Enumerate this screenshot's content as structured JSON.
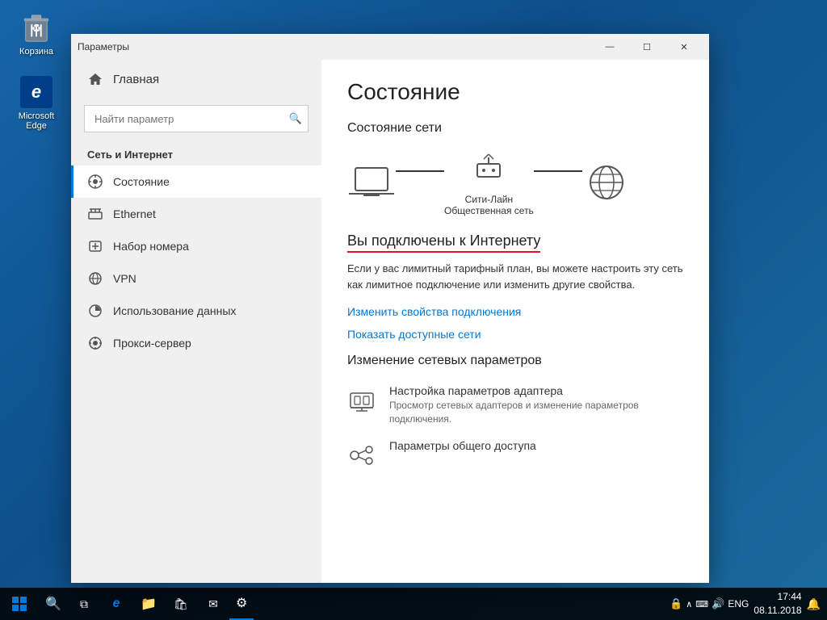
{
  "desktop": {
    "icons": [
      {
        "id": "recycle-bin",
        "label": "Корзина"
      },
      {
        "id": "edge",
        "label": "Microsoft Edge"
      }
    ]
  },
  "taskbar": {
    "time": "17:44",
    "date": "08.11.2018",
    "lang": "ENG",
    "apps": []
  },
  "window": {
    "title": "Параметры",
    "controls": {
      "minimize": "—",
      "maximize": "☐",
      "close": "✕"
    }
  },
  "sidebar": {
    "home_label": "Главная",
    "search_placeholder": "Найти параметр",
    "section_title": "Сеть и Интернет",
    "items": [
      {
        "id": "status",
        "label": "Состояние",
        "active": true
      },
      {
        "id": "ethernet",
        "label": "Ethernet"
      },
      {
        "id": "dialup",
        "label": "Набор номера"
      },
      {
        "id": "vpn",
        "label": "VPN"
      },
      {
        "id": "data-usage",
        "label": "Использование данных"
      },
      {
        "id": "proxy",
        "label": "Прокси-сервер"
      }
    ]
  },
  "content": {
    "page_title": "Состояние",
    "network_status_heading": "Состояние сети",
    "network_name": "Сити-Лайн",
    "network_type": "Общественная сеть",
    "connected_heading": "Вы подключены к Интернету",
    "connected_desc": "Если у вас лимитный тарифный план, вы можете настроить эту сеть как лимитное подключение или изменить другие свойства.",
    "link_properties": "Изменить свойства подключения",
    "link_networks": "Показать доступные сети",
    "change_settings_heading": "Изменение сетевых параметров",
    "adapter_settings_title": "Настройка параметров адаптера",
    "adapter_settings_desc": "Просмотр сетевых адаптеров и изменение параметров подключения.",
    "sharing_settings_title": "Параметры общего доступа"
  }
}
